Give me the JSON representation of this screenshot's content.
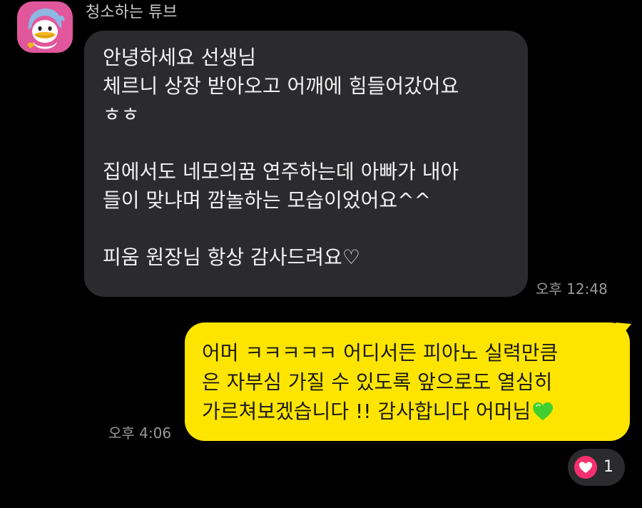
{
  "chat": {
    "sender": {
      "name": "청소하는 튜브",
      "avatar_icon": "tube-duck-avatar"
    },
    "incoming_message": {
      "lines": [
        "안녕하세요 선생님",
        "체르니 상장 받아오고 어깨에 힘들어갔어요",
        "ㅎㅎ",
        "",
        "집에서도 네모의꿈 연주하는데 아빠가 내아",
        "들이 맞냐며 깜놀하는 모습이었어요^^",
        "",
        "피움 원장님 항상 감사드려요♡"
      ],
      "time": "오후 12:48"
    },
    "outgoing_message": {
      "lines": [
        "어머 ㅋㅋㅋㅋㅋ 어디서든 피아노 실력만큼",
        "은 자부심 가질 수 있도록 앞으로도 열심히",
        "가르쳐보겠습니다 !! 감사합니다 어머님"
      ],
      "trailing_emoji": "green-heart-icon",
      "time": "오후 4:06"
    },
    "reaction": {
      "icon": "heart-icon",
      "count": "1"
    }
  },
  "colors": {
    "background": "#000000",
    "incoming_bubble": "#2b2b2d",
    "outgoing_bubble": "#fee500",
    "reaction_heart": "#f6306e",
    "green_heart": "#3fcf2f",
    "avatar_bg": "#e0579c"
  }
}
